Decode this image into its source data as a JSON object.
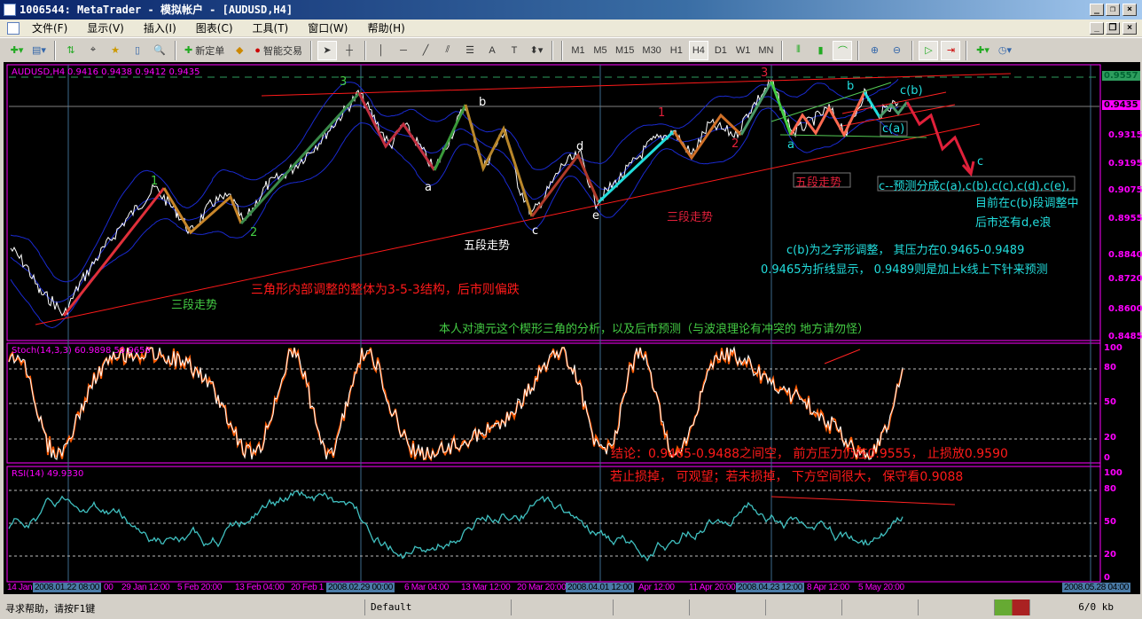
{
  "window": {
    "title": "1006544: MetaTrader - 模拟帐户 - [AUDUSD,H4]"
  },
  "menu": [
    "文件(F)",
    "显示(V)",
    "插入(I)",
    "图表(C)",
    "工具(T)",
    "窗口(W)",
    "帮助(H)"
  ],
  "toolbar": {
    "new_order": "新定单",
    "expert": "智能交易",
    "timeframes": [
      "M1",
      "M5",
      "M15",
      "M30",
      "H1",
      "H4",
      "D1",
      "W1",
      "MN"
    ],
    "active_timeframe": "H4"
  },
  "chart": {
    "header": "AUDUSD,H4",
    "ohlc": "0.9416 0.9438 0.9412 0.9435",
    "price_axis": [
      "0.9315",
      "0.9195",
      "0.9075",
      "0.8955",
      "0.8840",
      "0.8720",
      "0.8600",
      "0.8485"
    ],
    "price_marker_green": "0.9557",
    "price_marker_current": "0.9435",
    "wave_labels": {
      "w1": "1",
      "w2": "2",
      "w3": "3",
      "a1": "a",
      "b1": "b",
      "c1": "c",
      "d1": "d",
      "e1": "e",
      "r1": "1",
      "r2": "2",
      "r3": "3",
      "a2": "a",
      "b2": "b",
      "cb": "c(b)",
      "ca": "c(a)",
      "c2": "c"
    },
    "annotations": {
      "three_wave_green": "三段走势",
      "five_wave_white": "五段走势",
      "three_wave_red": "三段走势",
      "five_wave_red": "五段走势",
      "structure": "三角形内部调整的整体为3-5-3结构，后市则偏跌",
      "author": "本人对澳元这个楔形三角的分析，以及后市预测（与波浪理论有冲突的 地方请勿怪）",
      "forecast": "c--预测分成c(a),c(b),c(c),c(d),c(e),",
      "current": "目前在c(b)段调整中",
      "remaining": "后市还有d,e浪",
      "pressure": "c(b)为之字形调整， 其压力在0.9465-0.9489",
      "pressure_note": "0.9465为折线显示， 0.9489则是加上k线上下针来预测",
      "conclusion": "结论：0.9465-0.9488之间空， 前方压力仍在0.9555， 止损放0.9590",
      "advice": "若止损掉， 可观望；若未损掉， 下方空间很大， 保守看0.9088"
    },
    "stoch": {
      "header": "Stoch(14,3,3) 60.9898 59.9656",
      "levels": [
        "100",
        "80",
        "50",
        "20",
        "0"
      ]
    },
    "rsi": {
      "header": "RSI(14) 49.9330",
      "levels": [
        "100",
        "80",
        "50",
        "20",
        "0"
      ]
    },
    "time_axis": [
      "14 Jan",
      "2008.01.22 08:00",
      "00",
      "29 Jan 12:00",
      "5 Feb 20:00",
      "13 Feb 04:00",
      "20 Feb 1",
      "2008.02.29 00:00",
      "6 Mar 04:00",
      "13 Mar 12:00",
      "20 Mar 20:00",
      "2008.04.01 12:00",
      "Apr 12:00",
      "11 Apr 20:00",
      "2008.04.23 12:00",
      "8 Apr 12:00",
      "5 May 20:00",
      "2008.05.28 04:00"
    ]
  },
  "status": {
    "help": "寻求帮助，请按F1键",
    "profile": "Default",
    "traffic": "6/0 kb"
  }
}
